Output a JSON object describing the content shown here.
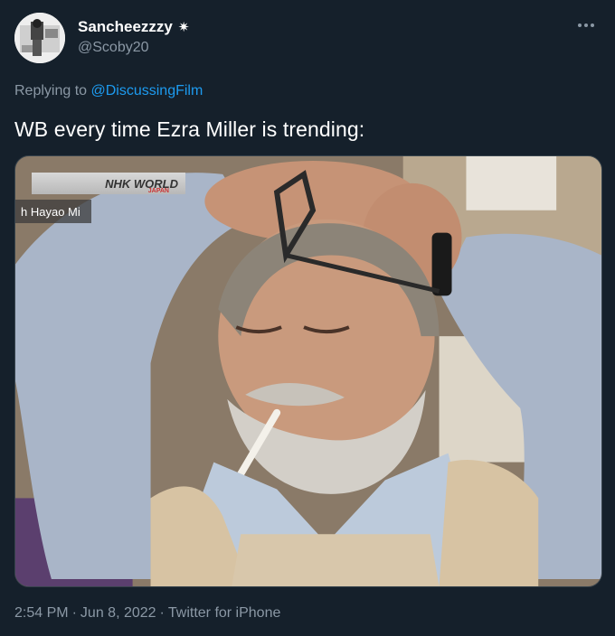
{
  "tweet": {
    "author": {
      "display_name": "Sancheezzzy",
      "name_symbol": "✷",
      "handle": "@Scoby20"
    },
    "more_icon": "ellipsis-icon",
    "reply": {
      "prefix": "Replying to",
      "mention": "@DiscussingFilm"
    },
    "text": "WB every time Ezra Miller is trending:",
    "media": {
      "badge": "NHK WORLD",
      "badge_sub": "JAPAN",
      "caption": "h Hayao Mi"
    },
    "footer": {
      "time": "2:54 PM",
      "sep1": "·",
      "date": "Jun 8, 2022",
      "sep2": "·",
      "source": "Twitter for iPhone"
    }
  },
  "colors": {
    "background": "#15202b",
    "secondary_text": "#8b98a5",
    "accent": "#1d9bf0"
  }
}
